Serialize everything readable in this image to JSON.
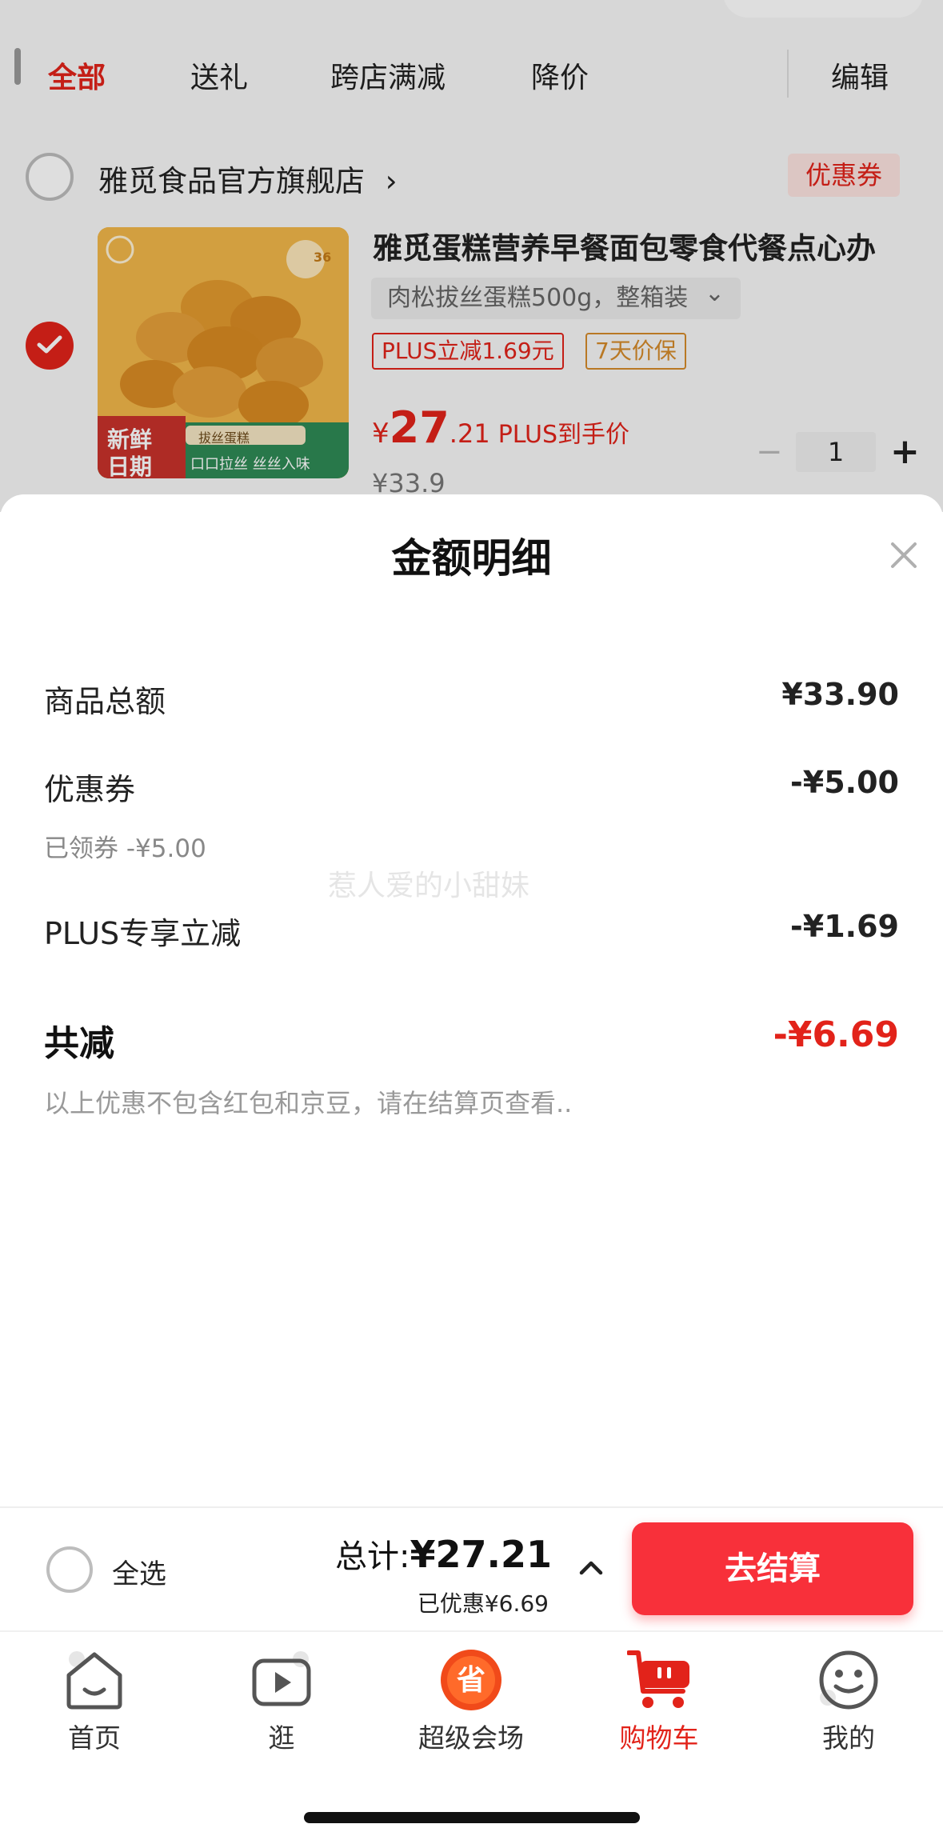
{
  "tabs": {
    "all": "全部",
    "gift": "送礼",
    "cross_store": "跨店满减",
    "price_drop": "降价",
    "edit": "编辑"
  },
  "store": {
    "name": "雅觅食品官方旗舰店",
    "chevron": "›",
    "coupon_tag": "优惠券"
  },
  "product": {
    "title": "雅觅蛋糕营养早餐面包零食代餐点心办",
    "spec": "肉松拔丝蛋糕500g，整箱装",
    "spec_chevron": "⌄",
    "plus_discount_tag": "PLUS立减1.69元",
    "price_protect_tag": "7天价保",
    "price_currency": "¥",
    "price_int": "27",
    "price_dec": ".21",
    "price_label": "PLUS到手价",
    "original_price": "¥33.9",
    "quantity": "1",
    "image_text": {
      "fresh": "新鲜",
      "date": "日期",
      "slogan": "口口拉丝 丝丝入味",
      "subtitle": "拔丝蛋糕",
      "badge": "36"
    }
  },
  "sheet": {
    "title": "金额明细",
    "rows": [
      {
        "label": "商品总额",
        "value": "¥33.90"
      },
      {
        "label": "优惠券",
        "value": "-¥5.00",
        "sub": "已领券 -¥5.00"
      },
      {
        "label": "PLUS专享立减",
        "value": "-¥1.69"
      }
    ],
    "total_label": "共减",
    "total_value": "-¥6.69",
    "note": "以上优惠不包含红包和京豆，请在结算页查看..",
    "watermark": "惹人爱的小甜妹"
  },
  "checkout": {
    "select_all": "全选",
    "total_label": "总计:",
    "total_amount": "¥27.21",
    "saved": "已优惠¥6.69",
    "button": "去结算"
  },
  "tabbar": {
    "items": [
      {
        "label": "首页",
        "icon": "home-icon"
      },
      {
        "label": "逛",
        "icon": "video-icon"
      },
      {
        "label": "超级会场",
        "icon": "super-venue-icon",
        "icon_text": "省"
      },
      {
        "label": "购物车",
        "icon": "cart-icon"
      },
      {
        "label": "我的",
        "icon": "smile-icon"
      }
    ],
    "active_index": 3
  },
  "colors": {
    "accent": "#e2231a",
    "checkout_button": "#f8303a",
    "coupon_bg": "#fde4e1"
  }
}
